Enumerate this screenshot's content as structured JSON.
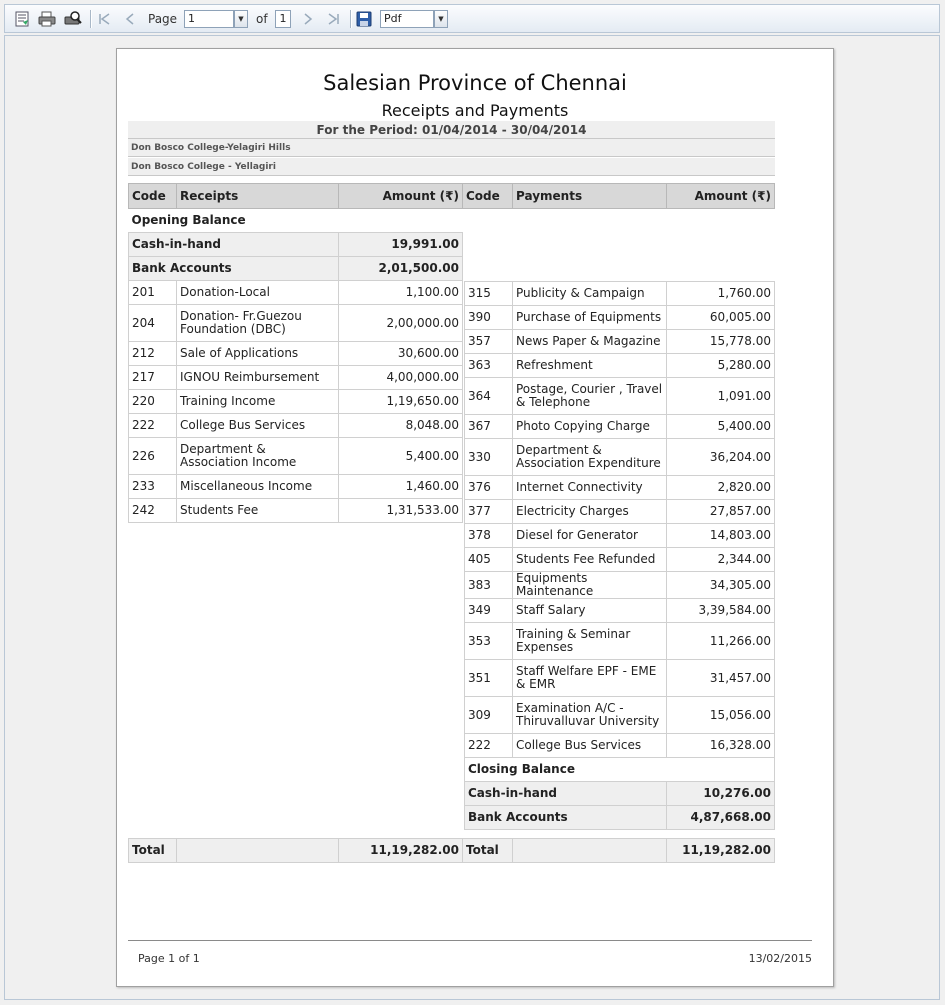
{
  "toolbar": {
    "page_label": "Page",
    "page_value": "1",
    "of_label": "of",
    "total_pages": "1",
    "export_format": "Pdf"
  },
  "report": {
    "title": "Salesian Province of Chennai",
    "subtitle": "Receipts and Payments",
    "period": "For the Period: 01/04/2014 - 30/04/2014",
    "institution": "Don Bosco College-Yelagiri Hills",
    "unit": "Don Bosco College - Yellagiri"
  },
  "receipts": {
    "headers": {
      "code": "Code",
      "name": "Receipts",
      "amount": "Amount (₹)"
    },
    "opening_label": "Opening Balance",
    "cash_label": "Cash-in-hand",
    "cash_value": "19,991.00",
    "bank_label": "Bank Accounts",
    "bank_value": "2,01,500.00",
    "rows": [
      {
        "code": "201",
        "name": "Donation-Local",
        "amount": "1,100.00"
      },
      {
        "code": "204",
        "name": "Donation- Fr.Guezou Foundation (DBC)",
        "amount": "2,00,000.00"
      },
      {
        "code": "212",
        "name": "Sale of Applications",
        "amount": "30,600.00"
      },
      {
        "code": "217",
        "name": "IGNOU Reimbursement",
        "amount": "4,00,000.00"
      },
      {
        "code": "220",
        "name": "Training Income",
        "amount": "1,19,650.00"
      },
      {
        "code": "222",
        "name": "College Bus Services",
        "amount": "8,048.00"
      },
      {
        "code": "226",
        "name": "Department & Association Income",
        "amount": "5,400.00"
      },
      {
        "code": "233",
        "name": "Miscellaneous Income",
        "amount": "1,460.00"
      },
      {
        "code": "242",
        "name": "Students  Fee",
        "amount": "1,31,533.00"
      }
    ],
    "total_label": "Total",
    "total_value": "11,19,282.00"
  },
  "payments": {
    "headers": {
      "code": "Code",
      "name": "Payments",
      "amount": "Amount (₹)"
    },
    "rows": [
      {
        "code": "315",
        "name": "Publicity & Campaign",
        "amount": "1,760.00"
      },
      {
        "code": "390",
        "name": "Purchase of Equipments",
        "amount": "60,005.00"
      },
      {
        "code": "357",
        "name": "News Paper & Magazine",
        "amount": "15,778.00"
      },
      {
        "code": "363",
        "name": "Refreshment",
        "amount": "5,280.00"
      },
      {
        "code": "364",
        "name": "Postage, Courier , Travel & Telephone",
        "amount": "1,091.00"
      },
      {
        "code": "367",
        "name": "Photo Copying Charge",
        "amount": "5,400.00"
      },
      {
        "code": "330",
        "name": "Department & Association Expenditure",
        "amount": "36,204.00"
      },
      {
        "code": "376",
        "name": "Internet Connectivity",
        "amount": "2,820.00"
      },
      {
        "code": "377",
        "name": "Electricity Charges",
        "amount": "27,857.00"
      },
      {
        "code": "378",
        "name": "Diesel for Generator",
        "amount": "14,803.00"
      },
      {
        "code": "405",
        "name": "Students Fee Refunded",
        "amount": "2,344.00"
      },
      {
        "code": "383",
        "name": "Equipments Maintenance",
        "amount": "34,305.00"
      },
      {
        "code": "349",
        "name": "Staff  Salary",
        "amount": "3,39,584.00"
      },
      {
        "code": "353",
        "name": "Training & Seminar Expenses",
        "amount": "11,266.00"
      },
      {
        "code": "351",
        "name": "Staff Welfare EPF - EME & EMR",
        "amount": "31,457.00"
      },
      {
        "code": "309",
        "name": "Examination  A/C - Thiruvalluvar University",
        "amount": "15,056.00"
      },
      {
        "code": "222",
        "name": "College Bus Services",
        "amount": "16,328.00"
      }
    ],
    "closing_label": "Closing Balance",
    "cash_label": "Cash-in-hand",
    "cash_value": "10,276.00",
    "bank_label": "Bank Accounts",
    "bank_value": "4,87,668.00",
    "total_label": "Total",
    "total_value": "11,19,282.00"
  },
  "footer": {
    "page_info": "Page 1 of 1",
    "date": "13/02/2015"
  }
}
